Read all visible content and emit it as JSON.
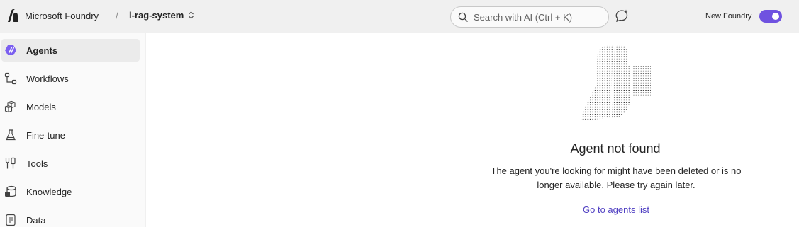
{
  "header": {
    "brand": "Microsoft Foundry",
    "separator": "/",
    "project": "l-rag-system",
    "search_placeholder": "Search with AI (Ctrl + K)",
    "new_foundry_label": "New Foundry",
    "new_foundry_enabled": true,
    "accent_color": "#6f52e0"
  },
  "sidebar": {
    "items": [
      {
        "label": "Agents",
        "icon": "agents-icon",
        "active": true
      },
      {
        "label": "Workflows",
        "icon": "workflow-icon",
        "active": false
      },
      {
        "label": "Models",
        "icon": "cube-icon",
        "active": false
      },
      {
        "label": "Fine-tune",
        "icon": "flask-icon",
        "active": false
      },
      {
        "label": "Tools",
        "icon": "tools-icon",
        "active": false
      },
      {
        "label": "Knowledge",
        "icon": "database-icon",
        "active": false
      },
      {
        "label": "Data",
        "icon": "document-icon",
        "active": false
      }
    ]
  },
  "main": {
    "title": "Agent not found",
    "message": "The agent you're looking for might have been deleted or is no longer available. Please try again later.",
    "link": "Go to agents list",
    "link_color": "#4f3fc2"
  }
}
